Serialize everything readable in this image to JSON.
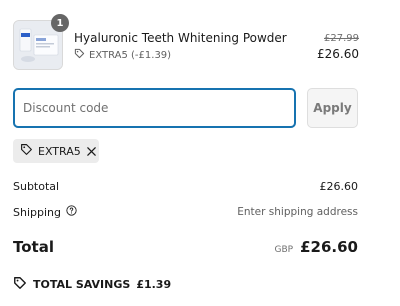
{
  "product": {
    "quantity": "1",
    "name": "Hyaluronic Teeth Whitening Powder",
    "discount_label": "EXTRA5 (-£1.39)",
    "price_original": "£27.99",
    "price_final": "£26.60",
    "thumbnail_icon": "product-thumbnail"
  },
  "discount_form": {
    "placeholder": "Discount code",
    "apply_label": "Apply"
  },
  "applied_code": {
    "code": "EXTRA5",
    "tag_icon": "tag-icon",
    "remove_icon": "close-icon"
  },
  "summary": {
    "subtotal_label": "Subtotal",
    "subtotal_value": "£26.60",
    "shipping_label": "Shipping",
    "shipping_value": "Enter shipping address",
    "shipping_help_icon": "help-icon",
    "total_label": "Total",
    "total_currency": "GBP",
    "total_value": "£26.60",
    "savings_label": "TOTAL SAVINGS",
    "savings_value": "£1.39"
  },
  "colors": {
    "focus_border": "#1773b0",
    "badge": "#666666",
    "chip_bg": "#ececec"
  }
}
